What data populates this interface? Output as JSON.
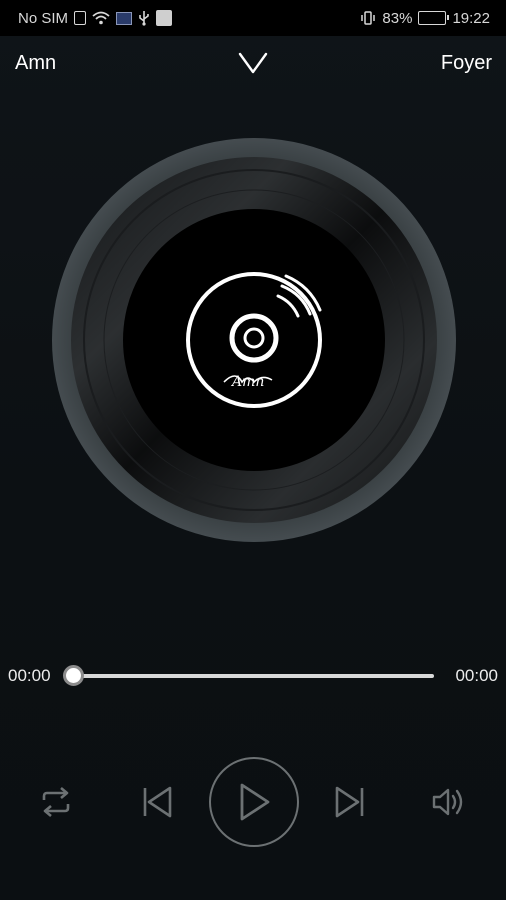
{
  "status_bar": {
    "carrier": "No SIM",
    "battery_text": "83%",
    "battery_level": 0.83,
    "time": "19:22",
    "icons": [
      "sim-card-icon",
      "wifi-icon",
      "flag-icon",
      "usb-icon",
      "gallery-icon",
      "vibrate-icon",
      "battery-icon"
    ]
  },
  "header": {
    "left_label": "Amn",
    "right_label": "Foyer",
    "collapse_icon": "chevron-down-icon"
  },
  "album": {
    "logo_text": "Amn",
    "icon": "vinyl-disc-icon"
  },
  "player": {
    "current_time": "00:00",
    "total_time": "00:00",
    "progress": 0,
    "controls": {
      "repeat_icon": "repeat-icon",
      "prev_icon": "skip-previous-icon",
      "play_icon": "play-icon",
      "next_icon": "skip-next-icon",
      "volume_icon": "volume-icon"
    }
  },
  "colors": {
    "background": "#0d1114",
    "accent": "#ffffff",
    "control_gray": "#6c7173",
    "vinyl_ring": "#3d4447"
  }
}
